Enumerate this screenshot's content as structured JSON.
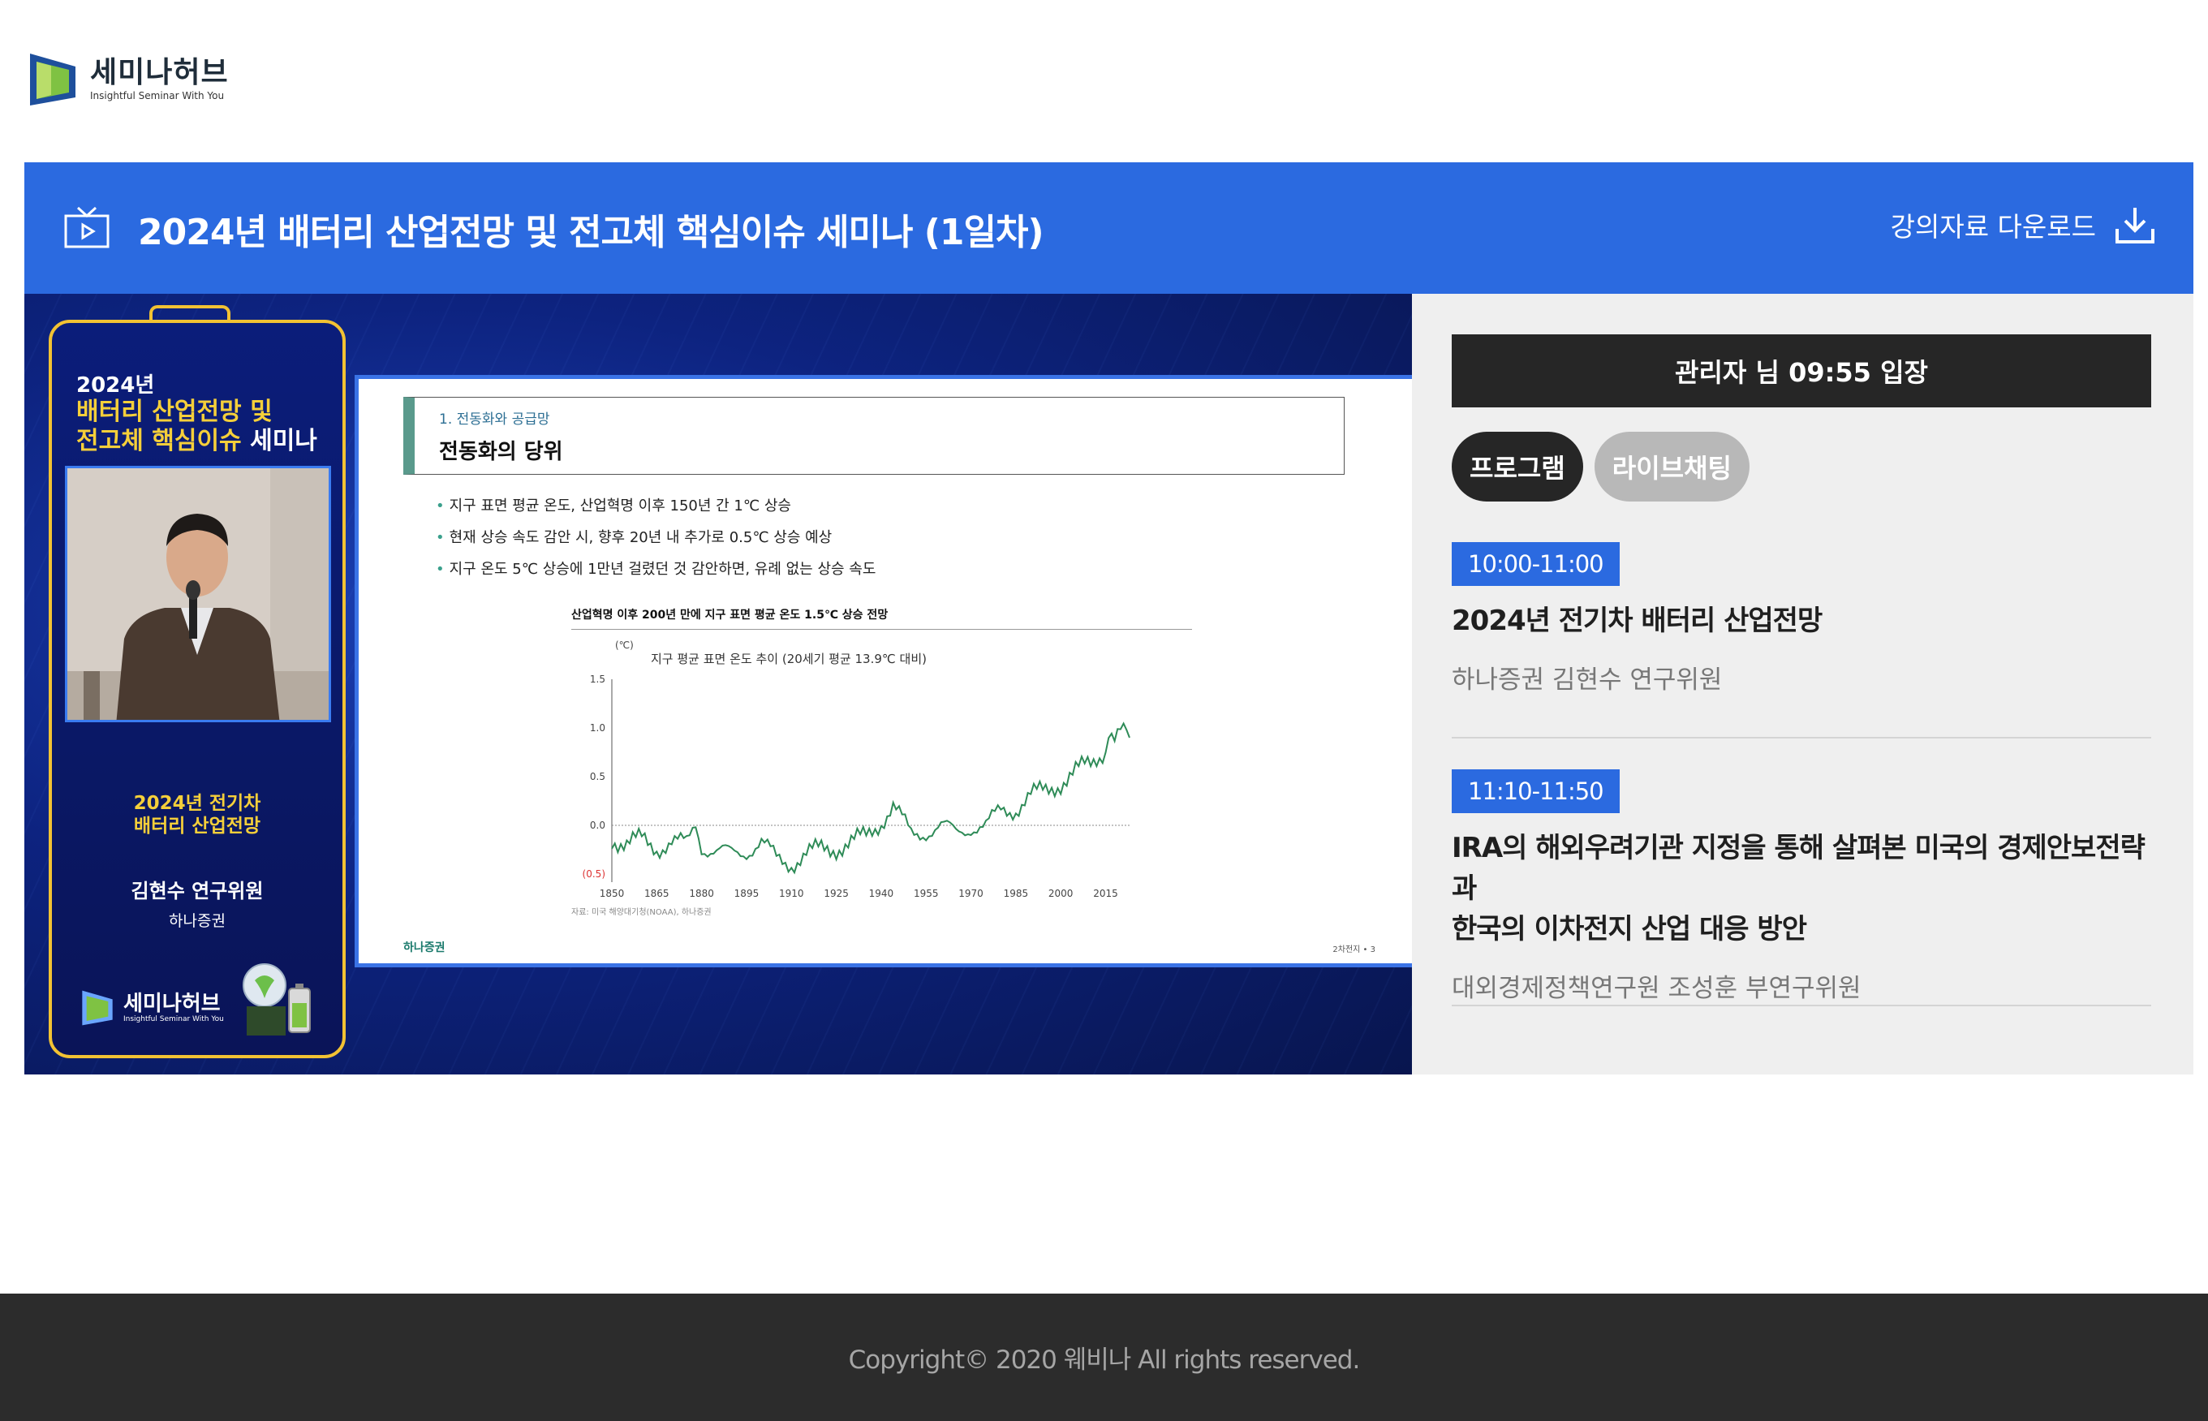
{
  "logo": {
    "name": "세미나허브",
    "tagline": "Insightful Seminar With You"
  },
  "header": {
    "title": "2024년 배터리 산업전망 및 전고체 핵심이슈 세미나 (1일차)",
    "download_label": "강의자료 다운로드",
    "bg_color": "#2b6ae0"
  },
  "video": {
    "card": {
      "year": "2024년",
      "title_line1": "배터리 산업전망 및",
      "title_line2a": "전고체 핵심이슈 ",
      "title_line2b": "세미나",
      "topic_line1": "2024년 전기차",
      "topic_line2": "배터리 산업전망",
      "speaker": "김현수 연구위원",
      "org": "하나증권",
      "logo_name": "세미나허브",
      "logo_tag": "Insightful Seminar With You"
    },
    "slide": {
      "section": "1. 전동화와 공급망",
      "title": "전동화의 당위",
      "bullets": [
        "지구 표면 평균 온도, 산업혁명 이후 150년 간 1℃ 상승",
        "현재 상승 속도 감안 시, 향후 20년 내 추가로 0.5℃ 상승 예상",
        "지구 온도 5℃ 상승에 1만년 걸렸던 것 감안하면, 유례 없는 상승 속도"
      ],
      "chart_title": "산업혁명 이후 200년 만에 지구 표면 평균 온도 1.5℃ 상승 전망",
      "source": "자료: 미국 해양대기청(NOAA), 하나증권",
      "footer_logo": "하나증권",
      "page": "2차전지 • 3"
    }
  },
  "chart_data": {
    "type": "line",
    "title": "지구 평균 표면 온도 추이 (20세기 평균 13.9℃ 대비)",
    "ylabel": "(℃)",
    "x_ticks": [
      "1850",
      "1865",
      "1880",
      "1895",
      "1910",
      "1925",
      "1940",
      "1955",
      "1970",
      "1985",
      "2000",
      "2015"
    ],
    "y_ticks": [
      "1.5",
      "1.0",
      "0.5",
      "0.0",
      "(0.5)"
    ],
    "xlim": [
      1850,
      2023
    ],
    "ylim": [
      -0.5,
      1.5
    ],
    "series": [
      {
        "color": "#2e8b57",
        "x": [
          1850,
          1855,
          1860,
          1865,
          1870,
          1875,
          1878,
          1880,
          1885,
          1890,
          1895,
          1900,
          1905,
          1910,
          1915,
          1920,
          1925,
          1930,
          1935,
          1940,
          1944,
          1950,
          1955,
          1960,
          1965,
          1970,
          1975,
          1980,
          1985,
          1990,
          1995,
          2000,
          2005,
          2010,
          2015,
          2016,
          2018,
          2020,
          2023
        ],
        "y": [
          -0.12,
          -0.2,
          -0.15,
          -0.22,
          -0.18,
          -0.2,
          0.03,
          -0.2,
          -0.28,
          -0.3,
          -0.25,
          -0.18,
          -0.35,
          -0.38,
          -0.3,
          -0.25,
          -0.22,
          -0.18,
          -0.12,
          0.05,
          0.2,
          -0.1,
          -0.05,
          -0.02,
          -0.08,
          0.0,
          -0.02,
          0.15,
          0.18,
          0.3,
          0.35,
          0.45,
          0.55,
          0.62,
          0.8,
          1.0,
          0.9,
          0.95,
          0.9
        ]
      }
    ]
  },
  "panel": {
    "entry_notice": "관리자 님 09:55 입장",
    "tabs": [
      "프로그램",
      "라이브채팅"
    ],
    "programs": [
      {
        "time": "10:00-11:00",
        "title": "2024년 전기차 배터리 산업전망",
        "speaker": "하나증권 김현수 연구위원"
      },
      {
        "time": "11:10-11:50",
        "title_line1": "IRA의 해외우려기관 지정을 통해 살펴본 미국의 경제안보전략과",
        "title_line2": "한국의 이차전지 산업 대응 방안",
        "speaker": "대외경제정책연구원 조성훈 부연구위원"
      }
    ]
  },
  "footer": {
    "copyright": "Copyright© 2020 웨비나 All rights reserved."
  }
}
